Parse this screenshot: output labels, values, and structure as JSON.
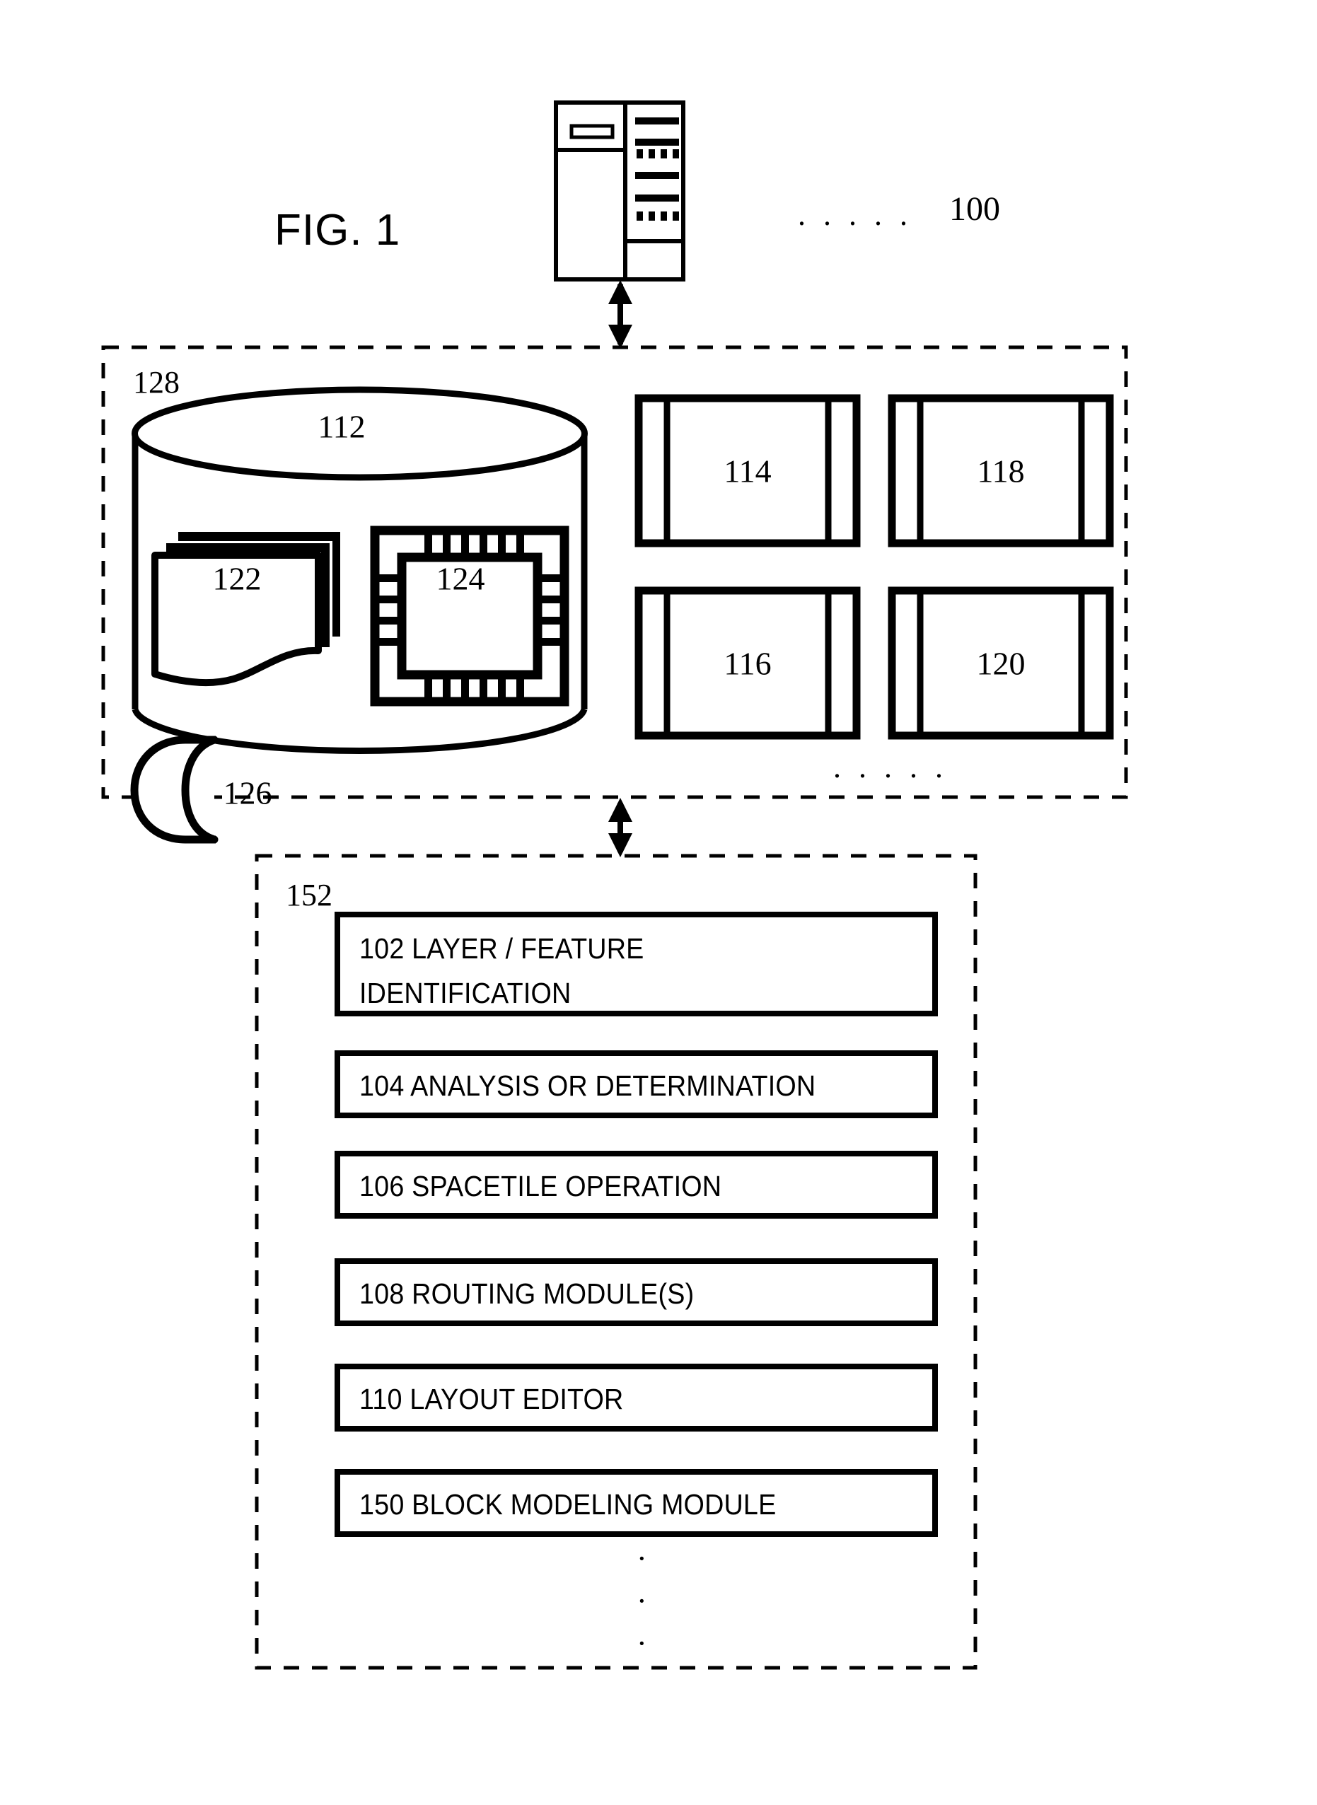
{
  "figure": {
    "label": "FIG. 1",
    "system_ref": "100"
  },
  "server": {
    "name": "server-rack-icon",
    "ellipsis": ". . . . ."
  },
  "storage_section": {
    "ref": "128",
    "database": {
      "ref": "112",
      "contents": [
        {
          "ref": "122",
          "icon": "document-stack-icon"
        },
        {
          "ref": "124",
          "icon": "integrated-circuit-chip-icon"
        },
        {
          "ref": "126",
          "icon": "book-icon"
        }
      ]
    },
    "blocks": [
      {
        "ref": "114"
      },
      {
        "ref": "118"
      },
      {
        "ref": "116"
      },
      {
        "ref": "120"
      }
    ],
    "ellipsis": ". . . . ."
  },
  "modules_section": {
    "ref": "152",
    "modules": [
      {
        "ref": "102",
        "name": "layer-feature-identification",
        "lines": [
          "102  LAYER / FEATURE",
          "IDENTIFICATION"
        ]
      },
      {
        "ref": "104",
        "name": "analysis-or-determination",
        "lines": [
          "104 ANALYSIS OR DETERMINATION"
        ]
      },
      {
        "ref": "106",
        "name": "spacetile-operation",
        "lines": [
          "106 SPACETILE OPERATION"
        ]
      },
      {
        "ref": "108",
        "name": "routing-modules",
        "lines": [
          "108  ROUTING MODULE(S)"
        ]
      },
      {
        "ref": "110",
        "name": "layout-editor",
        "lines": [
          "110  LAYOUT EDITOR"
        ]
      },
      {
        "ref": "150",
        "name": "block-modeling-module",
        "lines": [
          "150  BLOCK MODELING MODULE"
        ]
      }
    ],
    "vertical_ellipsis": [
      "·",
      "·",
      "·"
    ]
  },
  "colors": {
    "stroke": "#000000",
    "background": "#ffffff"
  }
}
